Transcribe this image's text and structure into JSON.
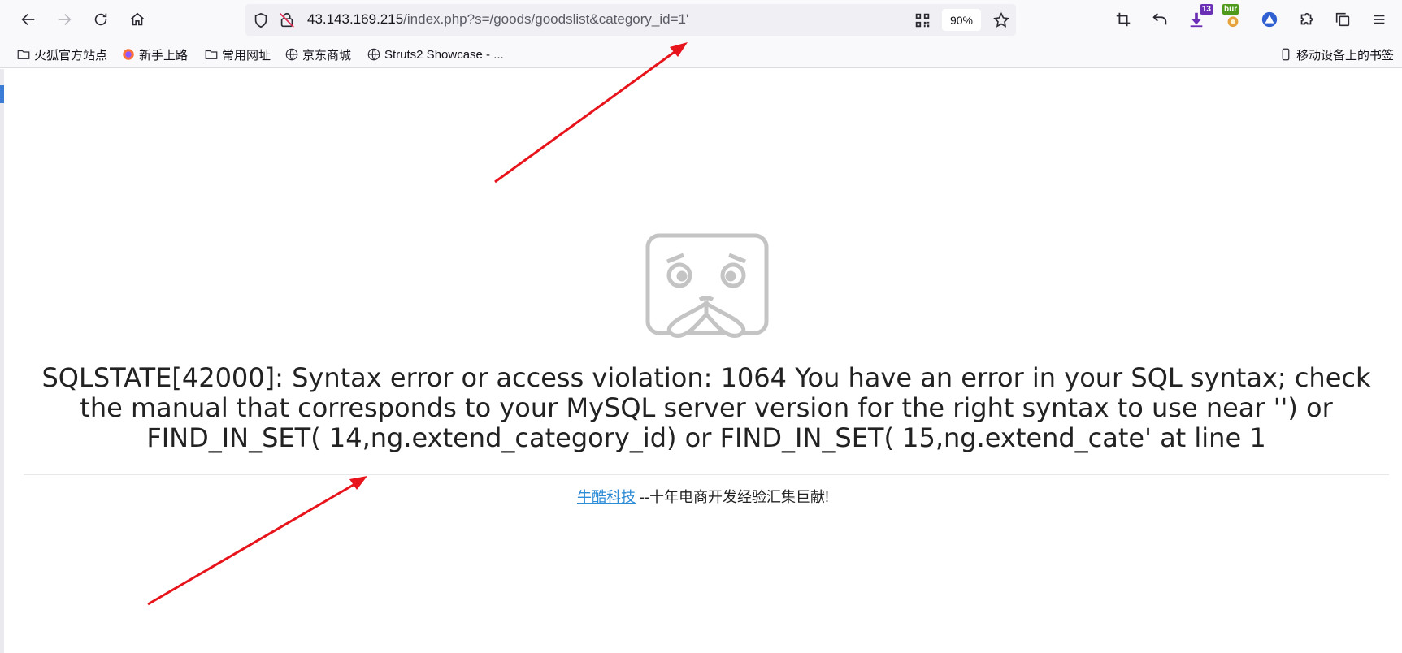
{
  "browser": {
    "url_host": "43.143.169.215",
    "url_path": "/index.php?s=/goods/goodslist&category_id=1'",
    "zoom": "90%",
    "download_badge": "13",
    "burp_label": "bur"
  },
  "bookmarks": [
    {
      "label": "火狐官方站点",
      "icon": "folder-icon"
    },
    {
      "label": "新手上路",
      "icon": "firefox-icon"
    },
    {
      "label": "常用网址",
      "icon": "folder-icon"
    },
    {
      "label": "京东商城",
      "icon": "globe-icon"
    },
    {
      "label": "Struts2 Showcase - ...",
      "icon": "globe-icon"
    }
  ],
  "mobile_bookmarks": "移动设备上的书签",
  "page": {
    "error_message": "SQLSTATE[42000]: Syntax error or access violation: 1064 You have an error in your SQL syntax; check the manual that corresponds to your MySQL server version for the right syntax to use near '') or FIND_IN_SET( 14,ng.extend_category_id) or FIND_IN_SET( 15,ng.extend_cate' at line 1",
    "footer_link": "牛酷科技",
    "footer_text": " --十年电商开发经验汇集巨献!"
  },
  "colors": {
    "annotation_arrow": "#e8141c",
    "link": "#2d8cd6"
  }
}
